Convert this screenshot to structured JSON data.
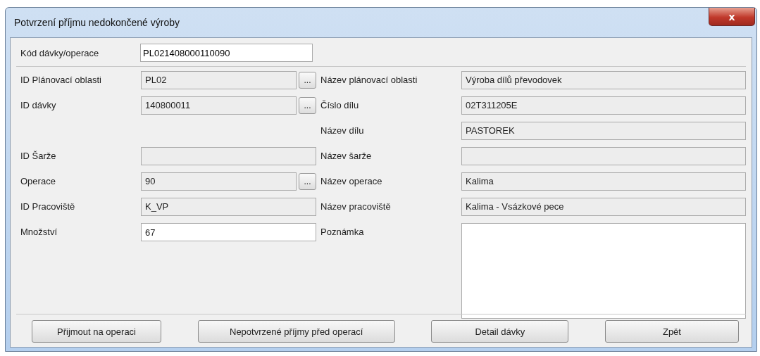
{
  "window": {
    "title": "Potvrzení příjmu nedokončené výroby",
    "close_label": "x"
  },
  "code_field": {
    "label": "Kód dávky/operace",
    "value": "PL021408000110090",
    "kind": "editable"
  },
  "form": {
    "rows": [
      {
        "left": {
          "label": "ID Plánovací oblasti",
          "value": "PL02",
          "kind": "lookup",
          "button": "..."
        },
        "right": {
          "label": "Název plánovací oblasti",
          "value": "Výroba dílů převodovek",
          "kind": "readonly"
        }
      },
      {
        "left": {
          "label": "ID dávky",
          "value": "140800011",
          "kind": "lookup",
          "button": "..."
        },
        "right": {
          "label": "Číslo dílu",
          "value": "02T311205E",
          "kind": "readonly"
        }
      },
      {
        "right": {
          "label": "Název dílu",
          "value": "PASTOREK",
          "kind": "readonly"
        }
      },
      {
        "left": {
          "label": "ID Šarže",
          "kind": "readonly"
        },
        "right": {
          "label": "Název šarže",
          "kind": "readonly"
        }
      },
      {
        "left": {
          "label": "Operace",
          "value": "90",
          "kind": "lookup",
          "button": "..."
        },
        "right": {
          "label": "Název operace",
          "value": "Kalima",
          "kind": "readonly"
        }
      },
      {
        "left": {
          "label": "ID Pracoviště",
          "value": "K_VP",
          "kind": "readonly"
        },
        "right": {
          "label": "Název pracoviště",
          "value": "Kalima - Vsázkové pece",
          "kind": "readonly"
        }
      },
      {
        "left": {
          "label": "Množství",
          "value": "67",
          "kind": "editable"
        },
        "right": {
          "label": "Poznámka",
          "kind": "memo"
        }
      }
    ]
  },
  "buttons": [
    "Přijmout na operaci",
    "Nepotvrzené příjmy před operací",
    "Detail dávky",
    "Zpět"
  ]
}
